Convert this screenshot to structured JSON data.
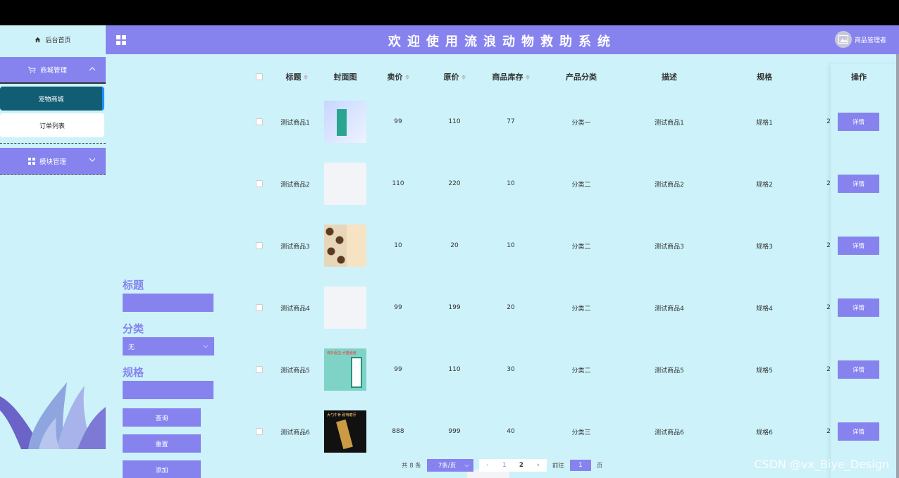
{
  "header": {
    "title": "欢迎使用流浪动物救助系统",
    "user_name": "商品管理者"
  },
  "sidebar": {
    "home_label": "后台首页",
    "group1_label": "商城管理",
    "group1_items": [
      {
        "label": "宠物商城",
        "active": true
      },
      {
        "label": "订单列表",
        "active": false
      }
    ],
    "group2_label": "模块管理"
  },
  "search": {
    "title_label": "标题",
    "category_label": "分类",
    "category_value": "无",
    "spec_label": "规格",
    "query_button": "查询",
    "reset_button": "重置",
    "add_button": "添加"
  },
  "table": {
    "columns": [
      "标题",
      "封面图",
      "卖价",
      "原价",
      "商品库存",
      "产品分类",
      "描述",
      "规格",
      "操作"
    ],
    "rows": [
      {
        "title": "测试商品1",
        "price": "99",
        "orig": "110",
        "stock": "77",
        "category": "分类一",
        "desc": "测试商品1",
        "spec": "规格1",
        "extra": "2",
        "thumb_caption": ""
      },
      {
        "title": "测试商品2",
        "price": "110",
        "orig": "220",
        "stock": "10",
        "category": "分类二",
        "desc": "测试商品2",
        "spec": "规格2",
        "extra": "2",
        "thumb_caption": ""
      },
      {
        "title": "测试商品3",
        "price": "10",
        "orig": "20",
        "stock": "10",
        "category": "分类二",
        "desc": "测试商品3",
        "spec": "规格3",
        "extra": "2",
        "thumb_caption": ""
      },
      {
        "title": "测试商品4",
        "price": "99",
        "orig": "199",
        "stock": "20",
        "category": "分类二",
        "desc": "测试商品4",
        "spec": "规格4",
        "extra": "2",
        "thumb_caption": ""
      },
      {
        "title": "测试商品5",
        "price": "99",
        "orig": "110",
        "stock": "30",
        "category": "分类二",
        "desc": "测试商品5",
        "spec": "规格5",
        "extra": "2",
        "thumb_caption": "体外驱虫 犬猫通用"
      },
      {
        "title": "测试商品6",
        "price": "888",
        "orig": "999",
        "stock": "40",
        "category": "分类三",
        "desc": "测试商品6",
        "spec": "规格6",
        "extra": "2",
        "thumb_caption": "大勺牛骨 耐啃磨牙"
      }
    ],
    "detail_button": "详情"
  },
  "pagination": {
    "total_text": "共 8 条",
    "page_size": "7条/页",
    "pages": [
      "1",
      "2"
    ],
    "current_page": "2",
    "goto_prefix": "前往",
    "goto_value": "1",
    "goto_suffix": "页"
  },
  "watermark": "CSDN @vx_Biye_Design",
  "colors": {
    "accent": "#8683ef",
    "background": "#cdf2fa",
    "active_item": "#115d74"
  }
}
